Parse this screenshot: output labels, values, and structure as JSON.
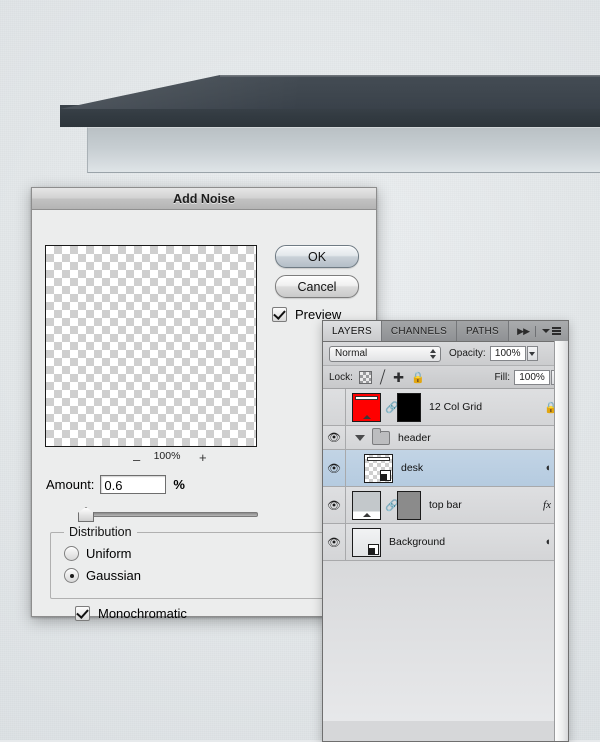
{
  "artwork": {
    "desk_color": "#3b434a",
    "topbar_color": "#c6cdd1"
  },
  "dialog": {
    "title": "Add Noise",
    "preview_zoom": {
      "minus": "–",
      "value": "100%",
      "plus": "+"
    },
    "amount": {
      "label": "Amount:",
      "value": "0.6",
      "unit": "%"
    },
    "distribution": {
      "legend": "Distribution",
      "options": [
        {
          "label": "Uniform",
          "selected": false
        },
        {
          "label": "Gaussian",
          "selected": true
        }
      ]
    },
    "monochromatic": {
      "label": "Monochromatic",
      "checked": true
    },
    "buttons": {
      "ok": "OK",
      "cancel": "Cancel"
    },
    "preview_checkbox": {
      "label": "Preview",
      "checked": true
    }
  },
  "layers_panel": {
    "tabs": [
      {
        "label": "LAYERS",
        "active": true
      },
      {
        "label": "CHANNELS",
        "active": false
      },
      {
        "label": "PATHS",
        "active": false
      }
    ],
    "blend_mode": "Normal",
    "opacity_label": "Opacity:",
    "opacity_value": "100%",
    "lock_label": "Lock:",
    "lock_icons": [
      "transparency-lock-icon",
      "paint-lock-icon",
      "move-lock-icon",
      "all-lock-icon"
    ],
    "fill_label": "Fill:",
    "fill_value": "100%",
    "layers": [
      {
        "name": "12 Col Grid",
        "visible": false,
        "selected": false,
        "kind": "layer",
        "thumb": "red",
        "mask": "black",
        "linked": true,
        "locked": true,
        "fx": false,
        "caret": false
      },
      {
        "name": "header",
        "visible": true,
        "selected": false,
        "kind": "group",
        "expanded": true
      },
      {
        "name": "desk",
        "visible": true,
        "selected": true,
        "kind": "layer",
        "thumb": "checker",
        "mask": null,
        "linked": false,
        "locked": false,
        "fx": false,
        "adjust": true,
        "caret": true
      },
      {
        "name": "top bar",
        "visible": true,
        "selected": false,
        "kind": "layer",
        "thumb": "topbar",
        "mask": "gray",
        "linked": true,
        "locked": false,
        "fx": true,
        "caret": true
      },
      {
        "name": "Background",
        "visible": true,
        "selected": false,
        "kind": "layer",
        "thumb": "bg",
        "mask": null,
        "linked": false,
        "locked": false,
        "fx": false,
        "adjust": true,
        "caret": true
      }
    ]
  }
}
